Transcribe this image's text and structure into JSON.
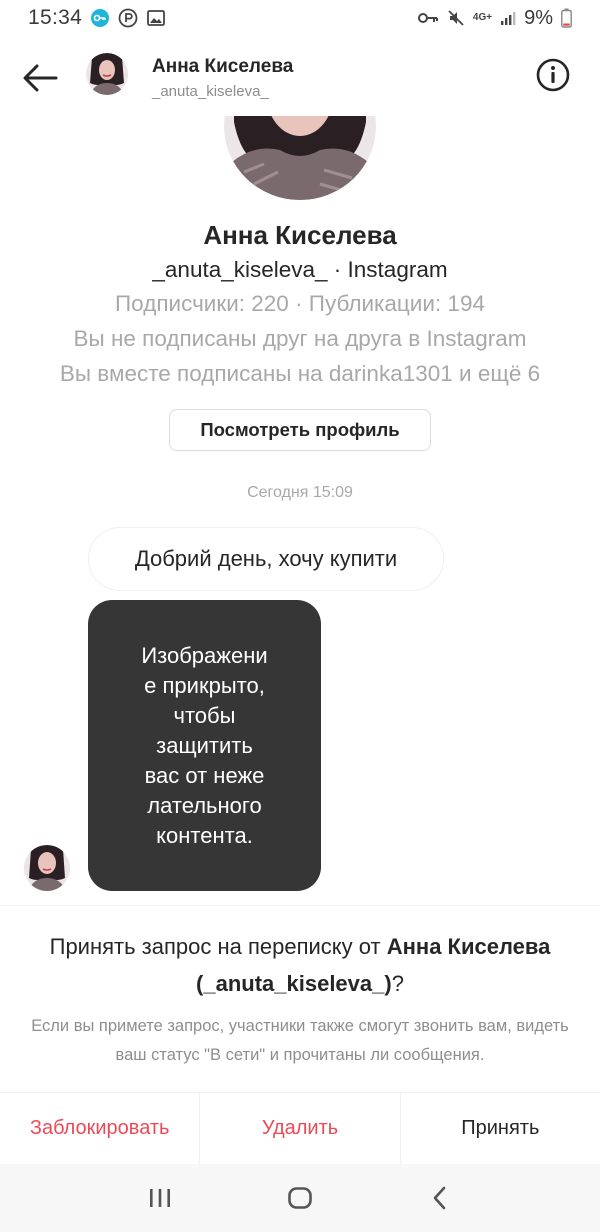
{
  "status_bar": {
    "time": "15:34",
    "battery": "9%",
    "network": "4G+",
    "icons_left": [
      "vpn-key-icon",
      "r-badge-icon",
      "image-icon"
    ],
    "icons_right": [
      "key-icon",
      "mute-icon",
      "network-4g-icon",
      "signal-icon",
      "battery-icon"
    ]
  },
  "header": {
    "name": "Анна Киселева",
    "handle": "_anuta_kiseleva_",
    "back_icon": "arrow-left-icon",
    "info_icon": "info-circle-icon"
  },
  "profile": {
    "name": "Анна Киселева",
    "handle_line": "_anuta_kiseleva_ · Instagram",
    "stats": "Подписчики: 220 · Публикации: 194",
    "follow_status": "Вы не подписаны друг на друга в Instagram",
    "mutual": "Вы вместе подписаны на darinka1301 и ещё 6",
    "view_button": "Посмотреть профиль"
  },
  "conversation": {
    "timestamp": "Сегодня 15:09",
    "messages": [
      {
        "text": "Добрий день, хочу купити"
      }
    ],
    "hidden_media_text": "Изображени\nе прикрыто,\nчтобы\nзащитить\nвас от неже\nлательного\nконтента."
  },
  "request": {
    "title_prefix": "Принять запрос на переписку от ",
    "title_name": "Анна Киселева (_anuta_kiseleva_)",
    "title_suffix": "?",
    "description": "Если вы примете запрос, участники также смогут звонить вам, видеть ваш статус \"В сети\" и прочитаны ли сообщения.",
    "actions": {
      "block": "Заблокировать",
      "delete": "Удалить",
      "accept": "Принять"
    }
  },
  "colors": {
    "danger": "#ed4956",
    "text": "#262626",
    "muted": "#a8a8a8",
    "media_bg": "#363636"
  },
  "navbar": {
    "icons": [
      "recents-icon",
      "home-icon",
      "back-icon"
    ]
  }
}
